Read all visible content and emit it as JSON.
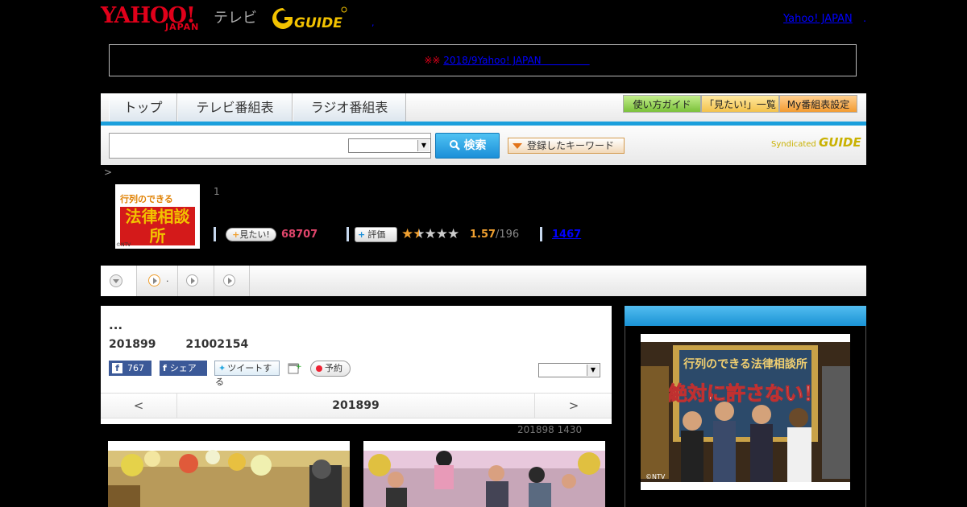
{
  "header": {
    "logo_yahoo": "YAHOO!",
    "logo_japan": "JAPAN",
    "logo_tv": "テレビ",
    "logo_gguide": "GUIDE",
    "top_link": "Yahoo! JAPAN",
    "sep_dot": ".",
    "small_dot": ","
  },
  "notice": {
    "marks": "※※",
    "link_text": "2018/9Yahoo! JAPAN　　　　　"
  },
  "nav": {
    "tabs": [
      "トップ",
      "テレビ番組表",
      "ラジオ番組表"
    ],
    "guide": "使い方ガイド",
    "mitai_list": "「見たい!」一覧",
    "my_settings": "My番組表設定"
  },
  "search": {
    "input_value": "",
    "select_value": "",
    "button_label": "検索",
    "keyword_button": "登録したキーワード",
    "syndicated_text": "Syndicated",
    "syndicated_logo": "GUIDE"
  },
  "breadcrumb": ">",
  "program": {
    "thumb_line1": "行列のできる",
    "thumb_line2": "法律相談所",
    "thumb_credit": "©NTV",
    "number": "1",
    "mitai_label": "見たい!",
    "mitai_count": "68707",
    "hyoka_label": "評価",
    "rating": "1.57",
    "rating_total": "/196",
    "review_count": "1467"
  },
  "tabs_row": {
    "tab2_suffix": "."
  },
  "main": {
    "title": "...",
    "date": "201899",
    "time": "21002154",
    "fb_count": "767",
    "share_label": "シェア",
    "tweet_label": "ツイートする",
    "yoyaku_label": "予約",
    "select_value": "",
    "pager_prev": "<",
    "pager_date": "201899",
    "pager_next": ">",
    "sub_info": "201898  1430"
  },
  "sidebar": {
    "photo_title": "行列のできる法律相談所",
    "photo_banner": "絶対に許さない！",
    "photo_credit": "©NTV"
  },
  "colors": {
    "accent_blue": "#1b9fdc",
    "yahoo_red": "#e0001a",
    "mitai_pink": "#e0456b",
    "rating_orange": "#f0a030"
  }
}
